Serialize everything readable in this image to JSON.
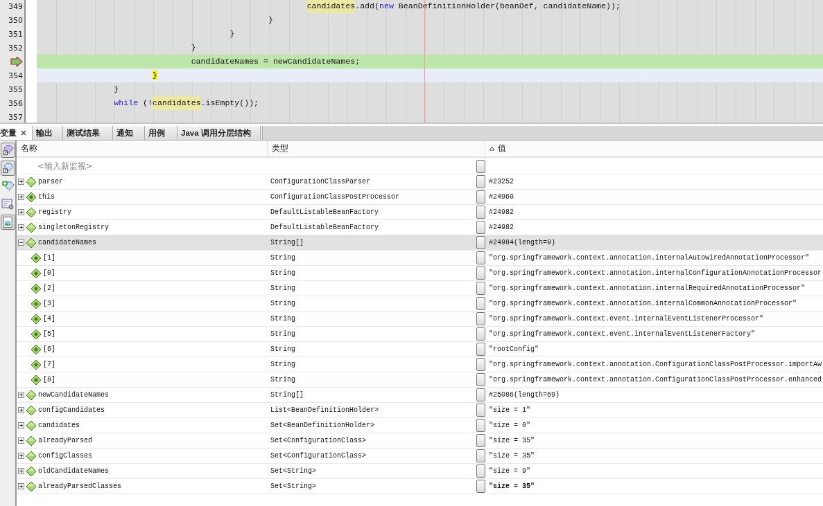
{
  "editor": {
    "lines": [
      {
        "number": "349",
        "current": false,
        "caret": false,
        "segments": [
          {
            "text": "                                                        candidates",
            "kind": "mark"
          },
          {
            "text": ".add(",
            "kind": "plain"
          },
          {
            "text": "new",
            "kind": "keyword"
          },
          {
            "text": " BeanDefinitionHolder(beanDef, candidateName));",
            "kind": "plain"
          }
        ]
      },
      {
        "number": "350",
        "current": false,
        "caret": false,
        "segments": [
          {
            "text": "                                                }",
            "kind": "plain"
          }
        ]
      },
      {
        "number": "351",
        "current": false,
        "caret": false,
        "segments": [
          {
            "text": "                                        }",
            "kind": "plain"
          }
        ]
      },
      {
        "number": "352",
        "current": false,
        "caret": false,
        "segments": [
          {
            "text": "                                }",
            "kind": "plain"
          }
        ]
      },
      {
        "current": true,
        "caret": false,
        "segments": [
          {
            "text": "                                candidateNames = newCandidateNames;",
            "kind": "plain"
          }
        ]
      },
      {
        "number": "354",
        "current": false,
        "caret": true,
        "segments": [
          {
            "text": "                        }",
            "kind": "brace"
          }
        ]
      },
      {
        "number": "355",
        "current": false,
        "caret": false,
        "segments": [
          {
            "text": "                }",
            "kind": "plain"
          }
        ]
      },
      {
        "number": "356",
        "current": false,
        "caret": false,
        "segments": [
          {
            "text": "                while",
            "kind": "keyword"
          },
          {
            "text": " (!",
            "kind": "plain"
          },
          {
            "text": "candidates",
            "kind": "mark"
          },
          {
            "text": ".isEmpty());",
            "kind": "plain"
          }
        ]
      },
      {
        "number": "357",
        "current": false,
        "caret": false
      }
    ]
  },
  "tabs": [
    {
      "label": "变量",
      "selected": true
    },
    {
      "label": "输出",
      "selected": false
    },
    {
      "label": "测试结果",
      "selected": false
    },
    {
      "label": "通知",
      "selected": false
    },
    {
      "label": "用例",
      "selected": false
    },
    {
      "label": "Java 调用分层结构",
      "selected": false
    }
  ],
  "variables": {
    "columns": [
      "名称",
      "类型",
      "值"
    ],
    "watch_placeholder": "<输入新监视>",
    "rows": [
      {
        "name": "parser",
        "type": "ConfigurationClassParser",
        "value": "#23252",
        "kind": "field",
        "expanded": false,
        "selected": false,
        "changed": false
      },
      {
        "name": "this",
        "type": "ConfigurationClassPostProcessor",
        "value": "#24960",
        "kind": "element",
        "expanded": false,
        "selected": false,
        "changed": false
      },
      {
        "name": "registry",
        "type": "DefaultListableBeanFactory",
        "value": "#24982",
        "kind": "field",
        "expanded": false,
        "selected": false,
        "changed": false
      },
      {
        "name": "singletonRegistry",
        "type": "DefaultListableBeanFactory",
        "value": "#24982",
        "kind": "field",
        "expanded": false,
        "selected": false,
        "changed": false
      },
      {
        "name": "candidateNames",
        "type": "String[]",
        "value": "#24984(length=9)",
        "kind": "field",
        "expanded": true,
        "selected": true,
        "changed": false,
        "children": [
          {
            "name": "[1]",
            "type": "String",
            "value": "\"org.springframework.context.annotation.internalAutowiredAnnotationProcessor\"",
            "kind": "element"
          },
          {
            "name": "[0]",
            "type": "String",
            "value": "\"org.springframework.context.annotation.internalConfigurationAnnotationProcessor",
            "kind": "element"
          },
          {
            "name": "[2]",
            "type": "String",
            "value": "\"org.springframework.context.annotation.internalRequiredAnnotationProcessor\"",
            "kind": "element"
          },
          {
            "name": "[3]",
            "type": "String",
            "value": "\"org.springframework.context.annotation.internalCommonAnnotationProcessor\"",
            "kind": "element"
          },
          {
            "name": "[4]",
            "type": "String",
            "value": "\"org.springframework.context.event.internalEventListenerProcessor\"",
            "kind": "element"
          },
          {
            "name": "[5]",
            "type": "String",
            "value": "\"org.springframework.context.event.internalEventListenerFactory\"",
            "kind": "element"
          },
          {
            "name": "[6]",
            "type": "String",
            "value": "\"rootConfig\"",
            "kind": "element"
          },
          {
            "name": "[7]",
            "type": "String",
            "value": "\"org.springframework.context.annotation.ConfigurationClassPostProcessor.importAw",
            "kind": "element"
          },
          {
            "name": "[8]",
            "type": "String",
            "value": "\"org.springframework.context.annotation.ConfigurationClassPostProcessor.enhanced",
            "kind": "element"
          }
        ]
      },
      {
        "name": "newCandidateNames",
        "type": "String[]",
        "value": "#25086(length=69)",
        "kind": "field",
        "expanded": false,
        "selected": false,
        "changed": false
      },
      {
        "name": "configCandidates",
        "type": "List<BeanDefinitionHolder>",
        "value": "\"size = 1\"",
        "kind": "field",
        "expanded": false,
        "selected": false,
        "changed": false
      },
      {
        "name": "candidates",
        "type": "Set<BeanDefinitionHolder>",
        "value": "\"size = 0\"",
        "kind": "field",
        "expanded": false,
        "selected": false,
        "changed": false
      },
      {
        "name": "alreadyParsed",
        "type": "Set<ConfigurationClass>",
        "value": "\"size = 35\"",
        "kind": "field",
        "expanded": false,
        "selected": false,
        "changed": false
      },
      {
        "name": "configClasses",
        "type": "Set<ConfigurationClass>",
        "value": "\"size = 35\"",
        "kind": "field",
        "expanded": false,
        "selected": false,
        "changed": false
      },
      {
        "name": "oldCandidateNames",
        "type": "Set<String>",
        "value": "\"size = 9\"",
        "kind": "field",
        "expanded": false,
        "selected": false,
        "changed": false
      },
      {
        "name": "alreadyParsedClasses",
        "type": "Set<String>",
        "value": "\"size = 35\"",
        "kind": "field",
        "expanded": false,
        "selected": false,
        "changed": true
      }
    ]
  }
}
